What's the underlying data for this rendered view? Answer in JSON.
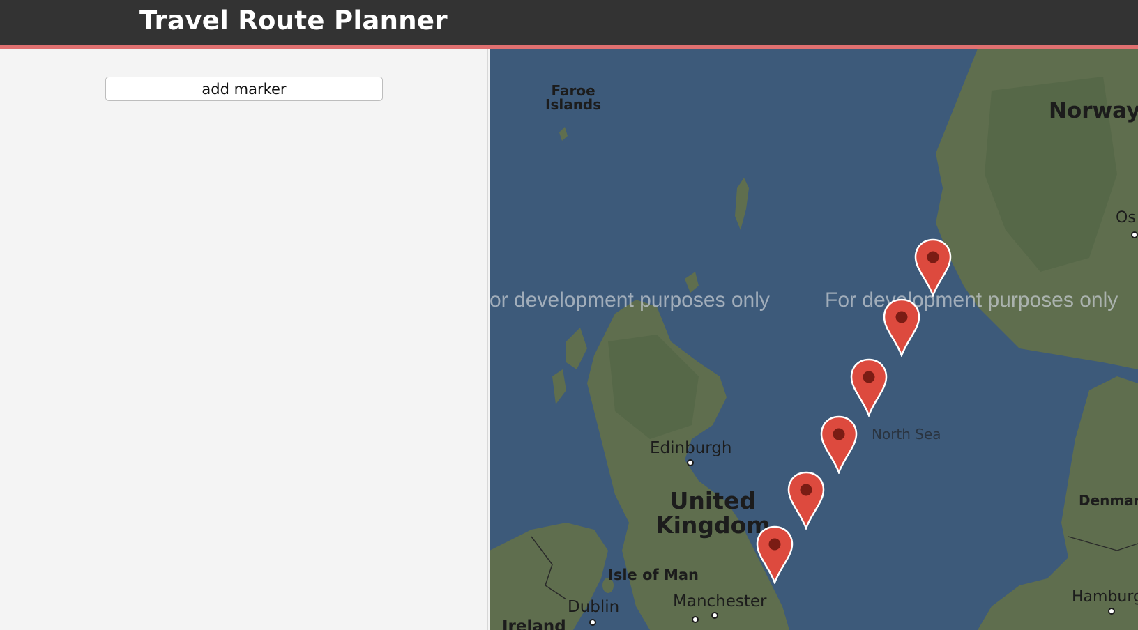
{
  "header": {
    "title": "Travel Route Planner"
  },
  "sidebar": {
    "add_marker_label": "add marker"
  },
  "map": {
    "colors": {
      "water": "#3d5a7a",
      "land": "#5f6e4e",
      "marker": "#dd4a3e"
    },
    "watermark_text": "For development purposes only",
    "watermark_text_clipped": "or development purposes only",
    "labels": {
      "faroe": "Faroe\nIslands",
      "norway": "Norway",
      "oslo": "Os",
      "north_sea": "North Sea",
      "edinburgh": "Edinburgh",
      "uk": "United\nKingdom",
      "isle_of_man": "Isle of Man",
      "dublin": "Dublin",
      "manchester": "Manchester",
      "denmark": "Denmar",
      "hamburg": "Hamburg",
      "ireland": "Ireland"
    },
    "marker_count": 6
  }
}
